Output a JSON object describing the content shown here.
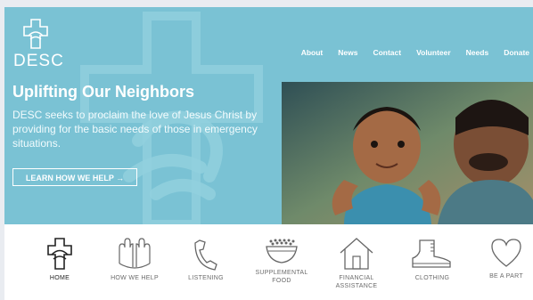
{
  "brand": {
    "name": "DESC"
  },
  "nav": {
    "items": [
      "About",
      "News",
      "Contact",
      "Volunteer",
      "Needs",
      "Donate"
    ]
  },
  "hero": {
    "headline": "Uplifting Our Neighbors",
    "subtext": "DESC seeks to proclaim the love of Jesus Christ by providing for the basic needs of those in emergency situations.",
    "cta_label": "LEARN HOW WE HELP →"
  },
  "icon_nav": {
    "items": [
      {
        "label": "HOME",
        "icon": "cross-hands-icon"
      },
      {
        "label": "HOW WE HELP",
        "icon": "raised-hands-icon"
      },
      {
        "label": "LISTENING",
        "icon": "phone-icon"
      },
      {
        "label": "SUPPLEMENTAL FOOD",
        "icon": "bowl-icon"
      },
      {
        "label": "FINANCIAL ASSISTANCE",
        "icon": "house-icon"
      },
      {
        "label": "CLOTHING",
        "icon": "boot-icon"
      },
      {
        "label": "BE A PART",
        "icon": "heart-icon"
      }
    ]
  },
  "colors": {
    "hero_bg": "#7ac2d4",
    "text_white": "#ffffff",
    "icon_stroke": "#555555"
  }
}
